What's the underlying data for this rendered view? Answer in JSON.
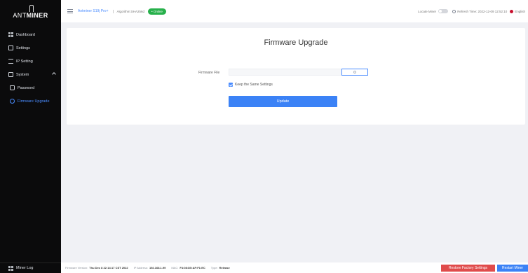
{
  "app": {
    "logo_text_light": "ANT",
    "logo_text_bold": "MINER"
  },
  "sidebar": {
    "items": [
      {
        "label": "Dashboard",
        "icon": "dashboard-icon"
      },
      {
        "label": "Settings",
        "icon": "settings-icon"
      },
      {
        "label": "IP Setting",
        "icon": "network-icon"
      },
      {
        "label": "System",
        "icon": "system-icon"
      },
      {
        "label": "Password",
        "icon": "lock-icon"
      },
      {
        "label": "Firmware Upgrade",
        "icon": "upgrade-icon"
      }
    ],
    "miner_log": "Miner Log"
  },
  "header": {
    "model": "Antminer S19j Pro+",
    "algorithm": "Algorithm:SHA256d",
    "status": "• Online",
    "locate_label": "Locate Miner",
    "refresh_label": "Refresh Time: 2022-12-09 12:52:10",
    "language": "English"
  },
  "main": {
    "title": "Firmware Upgrade",
    "file_label": "Firmware File",
    "keep_label": "Keep the Same Settings",
    "update_label": "Update"
  },
  "footer": {
    "fw_label": "Firmware Version:",
    "fw_value": "Thu Dec 8 22:14:17 CST 2022",
    "ip_label": "IP Address:",
    "ip_value": "192.168.1.99",
    "mac_label": "MAC:",
    "mac_value": "F4:08:D5:AF:F1:EC",
    "type_label": "Type:",
    "type_value": "Release",
    "restore_label": "Restore Factory Settings",
    "restart_label": "Restart Miner"
  },
  "colors": {
    "accent": "#3b82f6",
    "online": "#27b04b",
    "danger": "#e04b4b",
    "sidebar_bg": "#0b0b0c"
  }
}
